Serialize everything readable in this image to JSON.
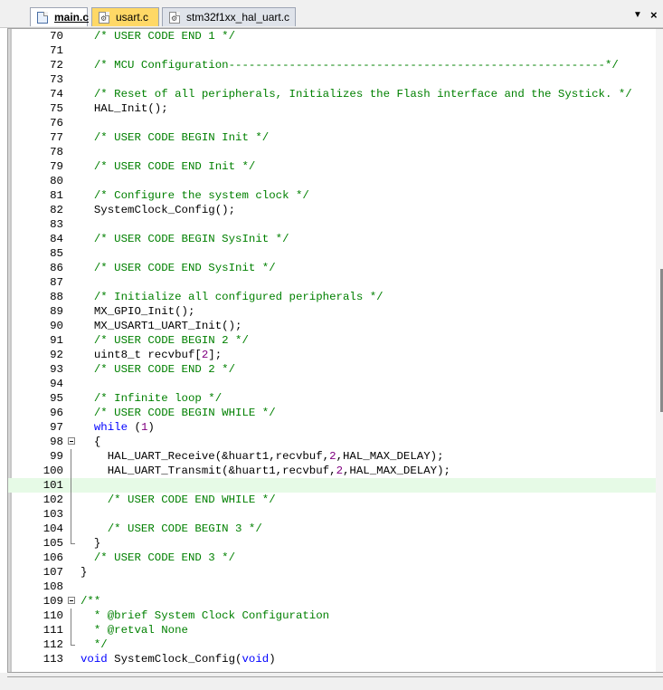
{
  "tabs": [
    {
      "label": "main.c",
      "active": true,
      "icon": "c-file-icon"
    },
    {
      "label": "usart.c",
      "modified": true,
      "icon": "c-file-gear-icon"
    },
    {
      "label": "stm32f1xx_hal_uart.c",
      "icon": "c-file-gear-icon"
    }
  ],
  "tab_controls": {
    "list": "▼",
    "close": "×"
  },
  "colors": {
    "comment": "#008000",
    "keyword": "#0000ff",
    "number": "#800080",
    "current_line": "#e6fae6",
    "active_tab_modified": "#ffd866"
  },
  "editor": {
    "current_line": 101,
    "lines": [
      {
        "num": "70",
        "code": "  /* USER CODE END 1 */"
      },
      {
        "num": "71",
        "code": ""
      },
      {
        "num": "72",
        "code": "  /* MCU Configuration--------------------------------------------------------*/"
      },
      {
        "num": "73",
        "code": ""
      },
      {
        "num": "74",
        "code": "  /* Reset of all peripherals, Initializes the Flash interface and the Systick. */"
      },
      {
        "num": "75",
        "code": "  HAL_Init();"
      },
      {
        "num": "76",
        "code": ""
      },
      {
        "num": "77",
        "code": "  /* USER CODE BEGIN Init */"
      },
      {
        "num": "78",
        "code": ""
      },
      {
        "num": "79",
        "code": "  /* USER CODE END Init */"
      },
      {
        "num": "80",
        "code": ""
      },
      {
        "num": "81",
        "code": "  /* Configure the system clock */"
      },
      {
        "num": "82",
        "code": "  SystemClock_Config();"
      },
      {
        "num": "83",
        "code": ""
      },
      {
        "num": "84",
        "code": "  /* USER CODE BEGIN SysInit */"
      },
      {
        "num": "85",
        "code": ""
      },
      {
        "num": "86",
        "code": "  /* USER CODE END SysInit */"
      },
      {
        "num": "87",
        "code": ""
      },
      {
        "num": "88",
        "code": "  /* Initialize all configured peripherals */"
      },
      {
        "num": "89",
        "code": "  MX_GPIO_Init();"
      },
      {
        "num": "90",
        "code": "  MX_USART1_UART_Init();"
      },
      {
        "num": "91",
        "code": "  /* USER CODE BEGIN 2 */"
      },
      {
        "num": "92",
        "code": "  uint8_t recvbuf[2];"
      },
      {
        "num": "93",
        "code": "  /* USER CODE END 2 */"
      },
      {
        "num": "94",
        "code": ""
      },
      {
        "num": "95",
        "code": "  /* Infinite loop */"
      },
      {
        "num": "96",
        "code": "  /* USER CODE BEGIN WHILE */"
      },
      {
        "num": "97",
        "code": "  while (1)"
      },
      {
        "num": "98",
        "code": "  {"
      },
      {
        "num": "99",
        "code": "    HAL_UART_Receive(&huart1,recvbuf,2,HAL_MAX_DELAY);"
      },
      {
        "num": "100",
        "code": "    HAL_UART_Transmit(&huart1,recvbuf,2,HAL_MAX_DELAY);"
      },
      {
        "num": "101",
        "code": ""
      },
      {
        "num": "102",
        "code": "    /* USER CODE END WHILE */"
      },
      {
        "num": "103",
        "code": ""
      },
      {
        "num": "104",
        "code": "    /* USER CODE BEGIN 3 */"
      },
      {
        "num": "105",
        "code": "  }"
      },
      {
        "num": "106",
        "code": "  /* USER CODE END 3 */"
      },
      {
        "num": "107",
        "code": "}"
      },
      {
        "num": "108",
        "code": ""
      },
      {
        "num": "109",
        "code": "/**"
      },
      {
        "num": "110",
        "code": "  * @brief System Clock Configuration"
      },
      {
        "num": "111",
        "code": "  * @retval None"
      },
      {
        "num": "112",
        "code": "  */"
      },
      {
        "num": "113",
        "code": "void SystemClock_Config(void)"
      }
    ]
  }
}
